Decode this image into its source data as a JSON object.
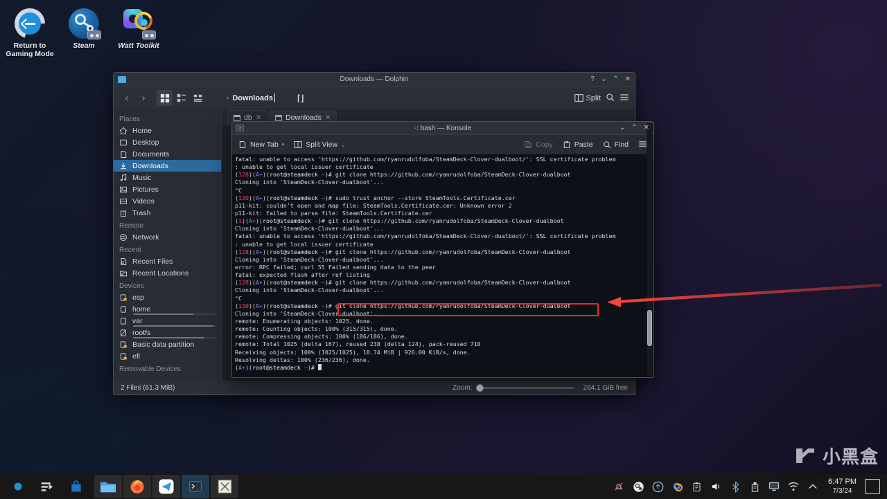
{
  "desktop": {
    "icons": [
      {
        "name": "Return to\nGaming Mode",
        "label_line1": "Return to",
        "label_line2": "Gaming Mode",
        "icon": "return-arrow-icon"
      },
      {
        "name": "Steam",
        "label_line1": "Steam",
        "label_line2": "",
        "icon": "steam-icon"
      },
      {
        "name": "Watt Toolkit",
        "label_line1": "Watt Toolkit",
        "label_line2": "",
        "icon": "watt-toolkit-icon"
      }
    ]
  },
  "dolphin": {
    "title": "Downloads — Dolphin",
    "window_buttons": {
      "help": "?",
      "minimize": "⌄",
      "maximize": "⌃",
      "close": "✕"
    },
    "toolbar": {
      "back": "‹",
      "forward": "›",
      "view_icons": "icons-view-icon",
      "view_compact": "compact-view-icon",
      "view_details": "details-view-icon",
      "split_label": "Split",
      "search": "search-icon",
      "menu": "hamburger-menu-icon"
    },
    "urlbar": {
      "chevron": "›",
      "path": "Downloads"
    },
    "tabs": [
      {
        "label": "db",
        "active": false
      },
      {
        "label": "Downloads",
        "active": true
      }
    ],
    "places": {
      "groups": [
        {
          "title": "Places",
          "items": [
            {
              "label": "Home",
              "icon": "home-icon",
              "selected": false
            },
            {
              "label": "Desktop",
              "icon": "desktop-icon",
              "selected": false
            },
            {
              "label": "Documents",
              "icon": "documents-icon",
              "selected": false
            },
            {
              "label": "Downloads",
              "icon": "downloads-icon",
              "selected": true
            },
            {
              "label": "Music",
              "icon": "music-icon",
              "selected": false
            },
            {
              "label": "Pictures",
              "icon": "pictures-icon",
              "selected": false
            },
            {
              "label": "Videos",
              "icon": "videos-icon",
              "selected": false
            },
            {
              "label": "Trash",
              "icon": "trash-icon",
              "selected": false
            }
          ]
        },
        {
          "title": "Remote",
          "items": [
            {
              "label": "Network",
              "icon": "network-icon",
              "selected": false
            }
          ]
        },
        {
          "title": "Recent",
          "items": [
            {
              "label": "Recent Files",
              "icon": "recent-files-icon",
              "selected": false
            },
            {
              "label": "Recent Locations",
              "icon": "recent-locations-icon",
              "selected": false
            }
          ]
        },
        {
          "title": "Devices",
          "items": [
            {
              "label": "esp",
              "icon": "locked-drive-icon",
              "selected": false,
              "usage": 0
            },
            {
              "label": "home",
              "icon": "drive-icon",
              "selected": false,
              "usage": 72
            },
            {
              "label": "var",
              "icon": "drive-icon",
              "selected": false,
              "usage": 96
            },
            {
              "label": "rootfs",
              "icon": "drive-readonly-icon",
              "selected": false,
              "usage": 84
            },
            {
              "label": "Basic data partition",
              "icon": "locked-drive-icon",
              "selected": false,
              "usage": 0
            },
            {
              "label": "efi",
              "icon": "locked-drive-icon",
              "selected": false,
              "usage": 0
            }
          ]
        },
        {
          "title": "Removable Devices",
          "items": []
        }
      ]
    },
    "statusbar": {
      "files": "2 Files (61.3 MiB)",
      "zoom_label": "Zoom:",
      "free": "264.1 GiB free"
    }
  },
  "konsole": {
    "title": "-: bash — Konsole",
    "window_buttons": {
      "minimize": "⌄",
      "maximize": "⌃",
      "close": "✕"
    },
    "toolbar": {
      "new_tab": "New Tab",
      "split_view": "Split View",
      "copy": "Copy",
      "paste": "Paste",
      "find": "Find",
      "menu": "hamburger-menu-icon"
    },
    "lines": [
      {
        "segs": [
          {
            "t": "fatal: unable to access 'https://github.com/ryanrudolfoba/SteamDeck-Clover-dualboot/': SSL certificate problem"
          }
        ]
      },
      {
        "segs": [
          {
            "t": ": unable to get local issuer certificate"
          }
        ]
      },
      {
        "segs": [
          {
            "t": "(",
            "c": ""
          },
          {
            "t": "128",
            "c": "c-red"
          },
          {
            "t": ")(",
            "c": ""
          },
          {
            "t": "A+",
            "c": "c-mag"
          },
          {
            "t": ")(",
            "c": ""
          },
          {
            "t": "root@steamdeck",
            "c": "c-wht"
          },
          {
            "t": " ",
            "c": ""
          },
          {
            "t": "~",
            "c": "c-mag"
          },
          {
            "t": ")# git clone https://github.com/ryanrudolfoba/SteamDeck-Clover-dualboot",
            "c": ""
          }
        ]
      },
      {
        "segs": [
          {
            "t": "Cloning into 'SteamDeck-Clover-dualboot'..."
          }
        ]
      },
      {
        "segs": [
          {
            "t": "^C"
          }
        ]
      },
      {
        "segs": [
          {
            "t": "(",
            "c": ""
          },
          {
            "t": "130",
            "c": "c-red"
          },
          {
            "t": ")(",
            "c": ""
          },
          {
            "t": "A+",
            "c": "c-mag"
          },
          {
            "t": ")(",
            "c": ""
          },
          {
            "t": "root@steamdeck",
            "c": "c-wht"
          },
          {
            "t": " ",
            "c": ""
          },
          {
            "t": "~",
            "c": "c-mag"
          },
          {
            "t": ")# sudo trust anchor --store SteamTools.Certificate.cer",
            "c": ""
          }
        ]
      },
      {
        "segs": [
          {
            "t": "p11-kit: couldn't open and map file: SteamTools.Certificate.cer: Unknown error 2"
          }
        ]
      },
      {
        "segs": [
          {
            "t": "p11-kit: failed to parse file: SteamTools.Certificate.cer"
          }
        ]
      },
      {
        "segs": [
          {
            "t": "(",
            "c": ""
          },
          {
            "t": "1",
            "c": "c-red"
          },
          {
            "t": ")(",
            "c": ""
          },
          {
            "t": "A+",
            "c": "c-mag"
          },
          {
            "t": ")(",
            "c": ""
          },
          {
            "t": "root@steamdeck",
            "c": "c-wht"
          },
          {
            "t": " ",
            "c": ""
          },
          {
            "t": "~",
            "c": "c-mag"
          },
          {
            "t": ")# git clone https://github.com/ryanrudolfoba/SteamDeck-Clover-dualboot",
            "c": ""
          }
        ]
      },
      {
        "segs": [
          {
            "t": "Cloning into 'SteamDeck-Clover-dualboot'..."
          }
        ]
      },
      {
        "segs": [
          {
            "t": "fatal: unable to access 'https://github.com/ryanrudolfoba/SteamDeck-Clover-dualboot/': SSL certificate problem"
          }
        ]
      },
      {
        "segs": [
          {
            "t": ": unable to get local issuer certificate"
          }
        ]
      },
      {
        "segs": [
          {
            "t": "(",
            "c": ""
          },
          {
            "t": "128",
            "c": "c-red"
          },
          {
            "t": ")(",
            "c": ""
          },
          {
            "t": "A+",
            "c": "c-mag"
          },
          {
            "t": ")(",
            "c": ""
          },
          {
            "t": "root@steamdeck",
            "c": "c-wht"
          },
          {
            "t": " ",
            "c": ""
          },
          {
            "t": "~",
            "c": "c-mag"
          },
          {
            "t": ")# git clone https://github.com/ryanrudolfoba/SteamDeck-Clover-dualboot",
            "c": ""
          }
        ]
      },
      {
        "segs": [
          {
            "t": "Cloning into 'SteamDeck-Clover-dualboot'..."
          }
        ]
      },
      {
        "segs": [
          {
            "t": "error: RPC failed; curl 55 Failed sending data to the peer"
          }
        ]
      },
      {
        "segs": [
          {
            "t": "fatal: expected flush after ref listing"
          }
        ]
      },
      {
        "segs": [
          {
            "t": "(",
            "c": ""
          },
          {
            "t": "128",
            "c": "c-red"
          },
          {
            "t": ")(",
            "c": ""
          },
          {
            "t": "A+",
            "c": "c-mag"
          },
          {
            "t": ")(",
            "c": ""
          },
          {
            "t": "root@steamdeck",
            "c": "c-wht"
          },
          {
            "t": " ",
            "c": ""
          },
          {
            "t": "~",
            "c": "c-mag"
          },
          {
            "t": ")# git clone https://github.com/ryanrudolfoba/SteamDeck-Clover-dualboot",
            "c": ""
          }
        ]
      },
      {
        "segs": [
          {
            "t": "Cloning into 'SteamDeck-Clover-dualboot'..."
          }
        ]
      },
      {
        "segs": [
          {
            "t": "^C"
          }
        ]
      },
      {
        "segs": [
          {
            "t": "(",
            "c": ""
          },
          {
            "t": "130",
            "c": "c-red"
          },
          {
            "t": ")(",
            "c": ""
          },
          {
            "t": "A+",
            "c": "c-mag"
          },
          {
            "t": ")(",
            "c": ""
          },
          {
            "t": "root@steamdeck",
            "c": "c-wht"
          },
          {
            "t": " ",
            "c": ""
          },
          {
            "t": "~",
            "c": "c-mag"
          },
          {
            "t": ")# git clone https://github.com/ryanrudolfoba/SteamDeck-Clover-dualboot",
            "c": ""
          }
        ]
      },
      {
        "segs": [
          {
            "t": "Cloning into 'SteamDeck-Clover-dualboot'..."
          }
        ]
      },
      {
        "segs": [
          {
            "t": "remote: Enumerating objects: 1025, done."
          }
        ]
      },
      {
        "segs": [
          {
            "t": "remote: Counting objects: 100% (315/315), done."
          }
        ]
      },
      {
        "segs": [
          {
            "t": "remote: Compressing objects: 100% (186/186), done."
          }
        ]
      },
      {
        "segs": [
          {
            "t": "remote: Total 1025 (delta 167), reused 238 (delta 124), pack-reused 710"
          }
        ]
      },
      {
        "segs": [
          {
            "t": "Receiving objects: 100% (1025/1025), 18.74 MiB | 926.00 KiB/s, done."
          }
        ]
      },
      {
        "segs": [
          {
            "t": "Resolving deltas: 100% (236/236), done."
          }
        ]
      },
      {
        "segs": [
          {
            "t": "(",
            "c": ""
          },
          {
            "t": "A+",
            "c": "c-mag"
          },
          {
            "t": ")(",
            "c": ""
          },
          {
            "t": "root@steamdeck",
            "c": "c-wht"
          },
          {
            "t": " ",
            "c": ""
          },
          {
            "t": "~",
            "c": "c-mag"
          },
          {
            "t": ")# ",
            "c": ""
          }
        ],
        "cursor": true
      }
    ]
  },
  "annotation": {
    "highlight_color": "#ec2c2c",
    "arrow_color": "#f2453d",
    "highlighted_command": "git clone https://github.com/ryanrudolfoba/SteamDeck-Clover-dualboot"
  },
  "watermark": {
    "text": "小黑盒"
  },
  "taskbar": {
    "launchers": [
      {
        "name": "application-launcher",
        "icon": "steamdeck-launcher-icon"
      },
      {
        "name": "task-switcher",
        "icon": "task-switcher-icon"
      },
      {
        "name": "discover-store",
        "icon": "discover-icon"
      }
    ],
    "windows": [
      {
        "name": "dolphin",
        "icon": "folder-icon",
        "state": "open"
      },
      {
        "name": "firefox",
        "icon": "firefox-icon",
        "state": "open"
      },
      {
        "name": "telegram",
        "icon": "telegram-icon",
        "state": "open"
      },
      {
        "name": "konsole",
        "icon": "terminal-icon",
        "state": "active"
      },
      {
        "name": "xterm",
        "icon": "xterm-icon",
        "state": "open"
      }
    ],
    "tray": [
      {
        "name": "notifications-muted-icon"
      },
      {
        "name": "steam-tray-icon"
      },
      {
        "name": "updates-icon"
      },
      {
        "name": "watt-toolkit-tray-icon"
      },
      {
        "name": "clipboard-icon"
      },
      {
        "name": "volume-icon"
      },
      {
        "name": "bluetooth-icon"
      },
      {
        "name": "usb-icon"
      },
      {
        "name": "display-icon"
      },
      {
        "name": "wifi-icon"
      },
      {
        "name": "show-hidden-icon"
      }
    ],
    "clock": {
      "time": "6:47 PM",
      "date": "7/3/24"
    },
    "show_desktop": "show-desktop-button"
  }
}
